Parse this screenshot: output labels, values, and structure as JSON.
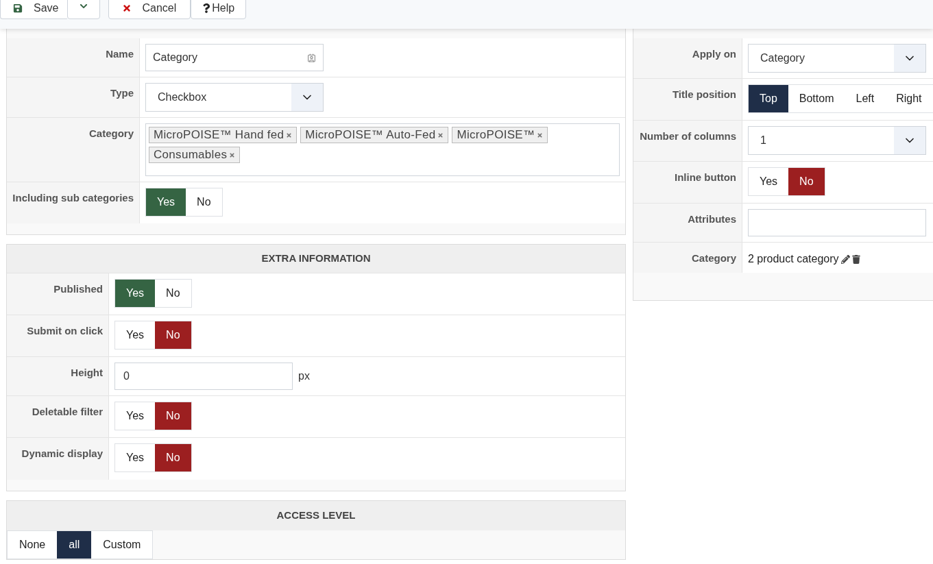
{
  "toolbar": {
    "buttons": [
      {
        "kind": "save",
        "label": "Save"
      },
      {
        "kind": "dropdown"
      },
      {
        "kind": "cancel",
        "label": "Cancel"
      },
      {
        "kind": "help",
        "label": "Help"
      }
    ]
  },
  "main": {
    "rows": [
      {
        "kind": "text",
        "label": "Name",
        "value": "Category"
      },
      {
        "kind": "select",
        "label": "Type",
        "value": "Checkbox"
      },
      {
        "kind": "tags",
        "label": "Category",
        "tags": [
          "MicroPOISE™ Hand fed",
          "MicroPOISE™ Auto-Fed",
          "MicroPOISE™",
          "Consumables"
        ]
      },
      {
        "kind": "yes_no",
        "label": "Including sub categories",
        "options": [
          {
            "label": "Yes",
            "selected": true
          },
          {
            "label": "No",
            "selected": false
          }
        ]
      }
    ]
  },
  "extra_information": {
    "title": "EXTRA INFORMATION",
    "rows": [
      {
        "kind": "yes_no",
        "label": "Published",
        "options": [
          {
            "label": "Yes",
            "selected": true
          },
          {
            "label": "No",
            "selected": false
          }
        ]
      },
      {
        "kind": "yes_no",
        "label": "Submit on click",
        "options": [
          {
            "label": "Yes",
            "selected": false
          },
          {
            "label": "No",
            "selected": true
          }
        ]
      },
      {
        "kind": "number",
        "label": "Height",
        "value": "0",
        "unit": "px"
      },
      {
        "kind": "yes_no",
        "label": "Deletable filter",
        "options": [
          {
            "label": "Yes",
            "selected": false
          },
          {
            "label": "No",
            "selected": true
          }
        ]
      },
      {
        "kind": "yes_no",
        "label": "Dynamic display",
        "options": [
          {
            "label": "Yes",
            "selected": false
          },
          {
            "label": "No",
            "selected": true
          }
        ]
      }
    ]
  },
  "access_level": {
    "title": "ACCESS LEVEL",
    "options": [
      {
        "label": "None",
        "selected": false
      },
      {
        "label": "all",
        "selected": true
      },
      {
        "label": "Custom",
        "selected": false
      }
    ]
  },
  "side": {
    "rows": [
      {
        "kind": "select",
        "label": "Apply on",
        "value": "Category"
      },
      {
        "kind": "choice",
        "label": "Title position",
        "options": [
          {
            "label": "Top",
            "selected": true
          },
          {
            "label": "Bottom",
            "selected": false
          },
          {
            "label": "Left",
            "selected": false
          },
          {
            "label": "Right",
            "selected": false
          }
        ]
      },
      {
        "kind": "select",
        "label": "Number of columns",
        "value": "1"
      },
      {
        "kind": "yes_no",
        "label": "Inline button",
        "options": [
          {
            "label": "Yes",
            "selected": false
          },
          {
            "label": "No",
            "selected": true
          }
        ]
      },
      {
        "kind": "input",
        "label": "Attributes"
      },
      {
        "kind": "info",
        "label": "Category",
        "value": "2 product category"
      }
    ]
  }
}
